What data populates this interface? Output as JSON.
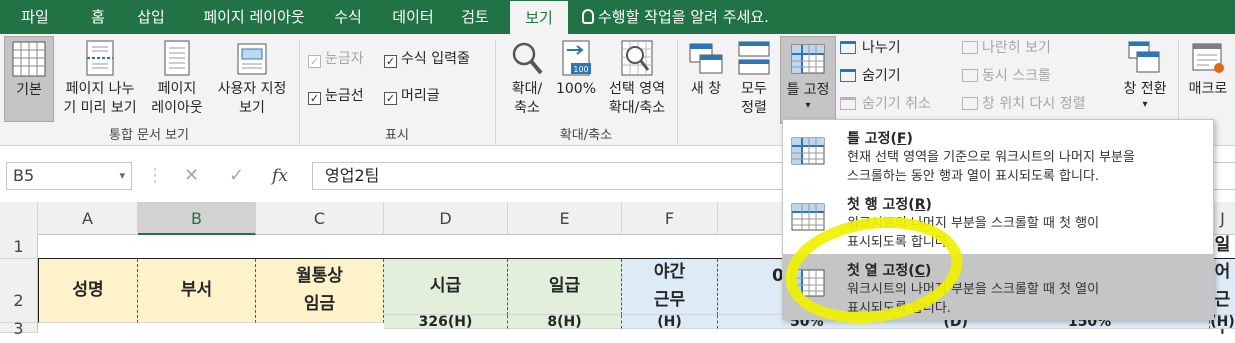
{
  "tabs": [
    "파일",
    "홈",
    "삽입",
    "페이지 레이아웃",
    "수식",
    "데이터",
    "검토",
    "보기"
  ],
  "tell_me": "수행할 작업을 알려 주세요.",
  "ribbon": {
    "basic": "기본",
    "page_break_1": "페이지 나누",
    "page_break_2": "기 미리 보기",
    "page_layout_1": "페이지",
    "page_layout_2": "레이아웃",
    "custom_view_1": "사용자 지정",
    "custom_view_2": "보기",
    "group_workbook_views": "통합 문서 보기",
    "ruler": "눈금자",
    "formula_bar": "수식 입력줄",
    "gridlines": "눈금선",
    "headings": "머리글",
    "group_show": "표시",
    "zoom_1": "확대/",
    "zoom_2": "축소",
    "zoom100": "100%",
    "zoom100_badge": "100",
    "zoom_sel_1": "선택 영역",
    "zoom_sel_2": "확대/축소",
    "group_zoom": "확대/축소",
    "new_window": "새 창",
    "arrange_1": "모두",
    "arrange_2": "정렬",
    "freeze_1": "틀 고정",
    "freeze_arrow": "▾",
    "split": "나누기",
    "hide": "숨기기",
    "unhide": "숨기기 취소",
    "side_by_side": "나란히 보기",
    "sync_scroll": "동시 스크롤",
    "reset_position": "창 위치 다시 정렬",
    "switch_windows": "창 전환",
    "macros": "매크로"
  },
  "name_box": "B5",
  "name_box_arrow": "▾",
  "cancel_glyph": "✕",
  "enter_glyph": "✓",
  "fx_glyph": "fx",
  "formula": "영업2팀",
  "columns": [
    "A",
    "B",
    "C",
    "D",
    "E",
    "F",
    "J"
  ],
  "rows": [
    "1",
    "2",
    "3"
  ],
  "header_row": {
    "a": "성명",
    "b": "부서",
    "c1": "월통상",
    "c2": "임금",
    "d": "시급",
    "e": "일급",
    "f1": "야간",
    "f2": "근무",
    "g": "0",
    "j1": "일어",
    "j2": "근무"
  },
  "row3": {
    "d": "326(H)",
    "e": "8(H)",
    "f": "(H)",
    "g": "50%",
    "h": "(D)",
    "i": "150%",
    "j": "(H)"
  },
  "dropdown": [
    {
      "title": "틀 고정",
      "key": "F",
      "desc1": "현재 선택 영역을 기준으로 워크시트의 나머지 부분을",
      "desc2": "스크롤하는 동안 행과 열이 표시되도록 합니다."
    },
    {
      "title": "첫 행 고정",
      "key": "R",
      "desc1": "워크시트의 나머지 부분을 스크롤할 때 첫 행이",
      "desc2": "표시되도록 합니다."
    },
    {
      "title": "첫 열 고정",
      "key": "C",
      "desc1": "워크시트의 나머지 부분을 스크롤할 때 첫 열이",
      "desc2": "표시되도록 합니다."
    }
  ],
  "colors": {
    "accent": "#217346",
    "highlight": "#f0f000",
    "table_fill": "#fef2cb",
    "table_fill_blue": "#dcebf6"
  }
}
